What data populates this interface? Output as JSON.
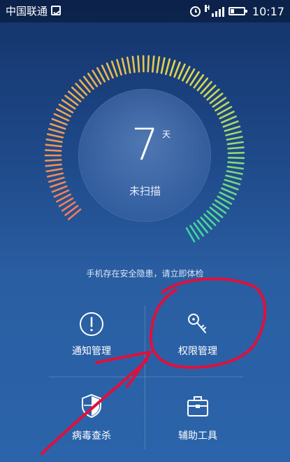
{
  "status_bar": {
    "carrier": "中国联通",
    "network": "H",
    "time": "10:17",
    "icons": [
      "image-icon",
      "alarm-icon",
      "signal-icon",
      "battery-icon"
    ]
  },
  "scan": {
    "days": "7",
    "days_unit": "天",
    "status": "未扫描",
    "warning": "手机存在安全隐患，请立即体检"
  },
  "tools": [
    {
      "label": "通知管理",
      "icon": "alert-circle-icon"
    },
    {
      "label": "权限管理",
      "icon": "key-icon"
    },
    {
      "label": "病毒查杀",
      "icon": "shield-icon"
    },
    {
      "label": "辅助工具",
      "icon": "toolbox-icon"
    }
  ],
  "colors": {
    "gauge_start": "#f07a5a",
    "gauge_mid": "#e6d64a",
    "gauge_end": "#39d6a0",
    "annotation": "#e0103c"
  }
}
